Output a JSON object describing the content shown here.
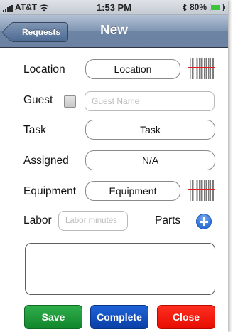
{
  "status_bar": {
    "carrier": "AT&T",
    "time": "1:53 PM",
    "battery_percent": "80%",
    "battery_level": 0.8,
    "icons": [
      "signal-icon",
      "wifi-icon",
      "bluetooth-icon",
      "battery-icon"
    ]
  },
  "nav": {
    "back_label": "Requests",
    "title": "New"
  },
  "form": {
    "location": {
      "label": "Location",
      "value": "Location"
    },
    "guest": {
      "label": "Guest",
      "checked": false,
      "placeholder": "Guest Name"
    },
    "task": {
      "label": "Task",
      "value": "Task"
    },
    "assigned": {
      "label": "Assigned",
      "value": "N/A"
    },
    "equipment": {
      "label": "Equipment",
      "value": "Equipment"
    },
    "labor": {
      "label": "Labor",
      "placeholder": "Labor minutes"
    },
    "parts": {
      "label": "Parts"
    },
    "notes": {
      "value": ""
    }
  },
  "actions": {
    "save_label": "Save",
    "complete_label": "Complete",
    "close_label": "Close"
  },
  "colors": {
    "nav_bar": "#6d84a4",
    "save": "#12862c",
    "complete": "#0a3fa6",
    "close": "#e60d00",
    "barcode_line": "#e02020",
    "add_button": "#2c6fd6"
  }
}
